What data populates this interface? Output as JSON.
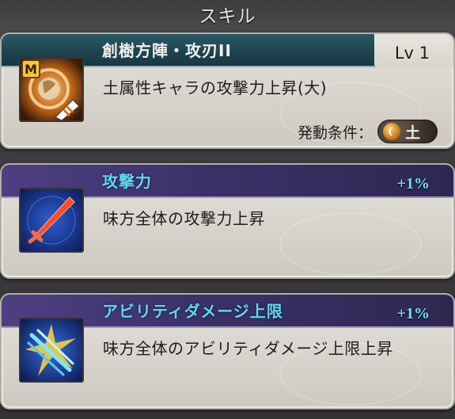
{
  "header": {
    "title": "スキル"
  },
  "skill": {
    "name": "創樹方陣・攻刃II",
    "level": "Lv 1",
    "description": "土属性キャラの攻撃力上昇(大)",
    "condition_label": "発動条件：",
    "condition_element": "土",
    "icon": "earth-blade-skill-icon",
    "icon_badge": "M"
  },
  "effects": [
    {
      "name": "攻撃力",
      "value": "+1%",
      "description": "味方全体の攻撃力上昇",
      "icon": "red-sword-icon"
    },
    {
      "name": "アビリティダメージ上限",
      "value": "+1%",
      "description": "味方全体のアビリティダメージ上限上昇",
      "icon": "blue-daggers-icon"
    }
  ],
  "colors": {
    "skill_bar": "#1e4450",
    "effect_bar": "#3b3169",
    "effect_title": "#5cd9f2",
    "percent": "#6fe3f5",
    "card_bg": "#dcd8d1"
  }
}
